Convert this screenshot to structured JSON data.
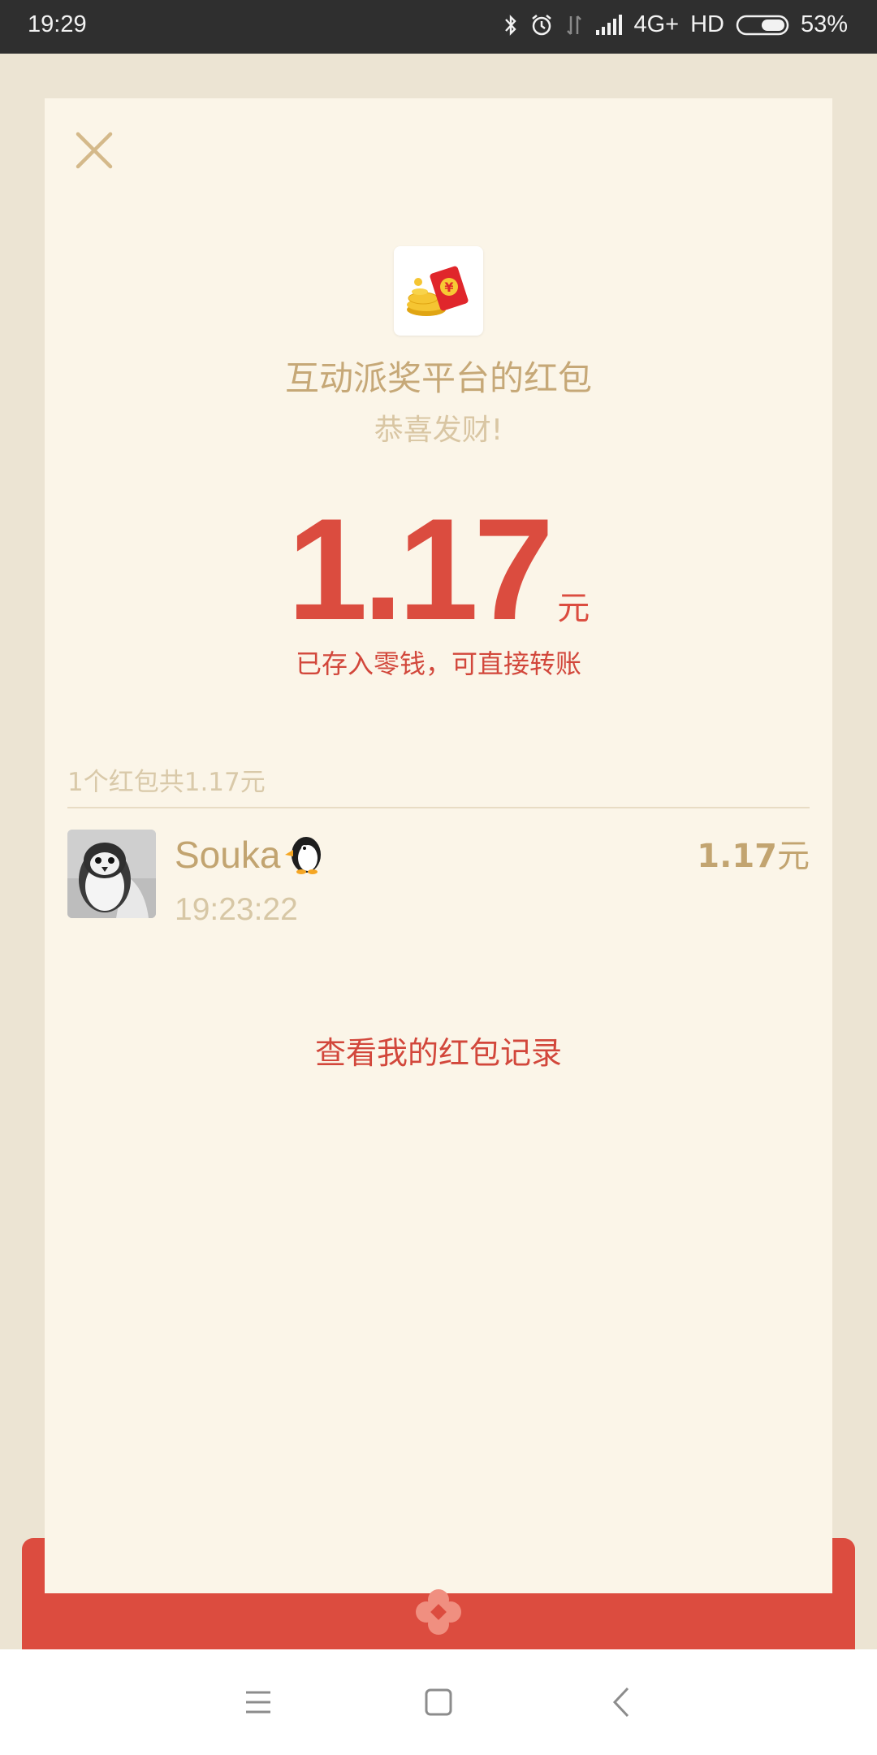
{
  "status_bar": {
    "time": "19:29",
    "network": "4G+",
    "hd": "HD",
    "battery": "53%",
    "icons": [
      "bluetooth-icon",
      "alarm-icon",
      "data-transfer-icon",
      "signal-icon",
      "battery-icon"
    ]
  },
  "card": {
    "sender_title": "互动派奖平台的红包",
    "greeting": "恭喜发财!",
    "amount": "1.17",
    "amount_unit": "元",
    "wallet_note": "已存入零钱，可直接转账",
    "summary": "1个红包共1.17元",
    "records": [
      {
        "name": "Souka",
        "name_emoji": "penguin-icon",
        "time": "19:23:22",
        "amount": "1.17",
        "amount_unit": "元"
      }
    ],
    "history_link": "查看我的红包记录"
  },
  "nav_bar": {
    "buttons": [
      "menu-icon",
      "home-icon",
      "back-icon"
    ]
  },
  "colors": {
    "accent_red": "#db4c3f",
    "gold_text": "#c6a877",
    "card_bg": "#fbf5e8",
    "page_bg": "#ece4d3"
  }
}
